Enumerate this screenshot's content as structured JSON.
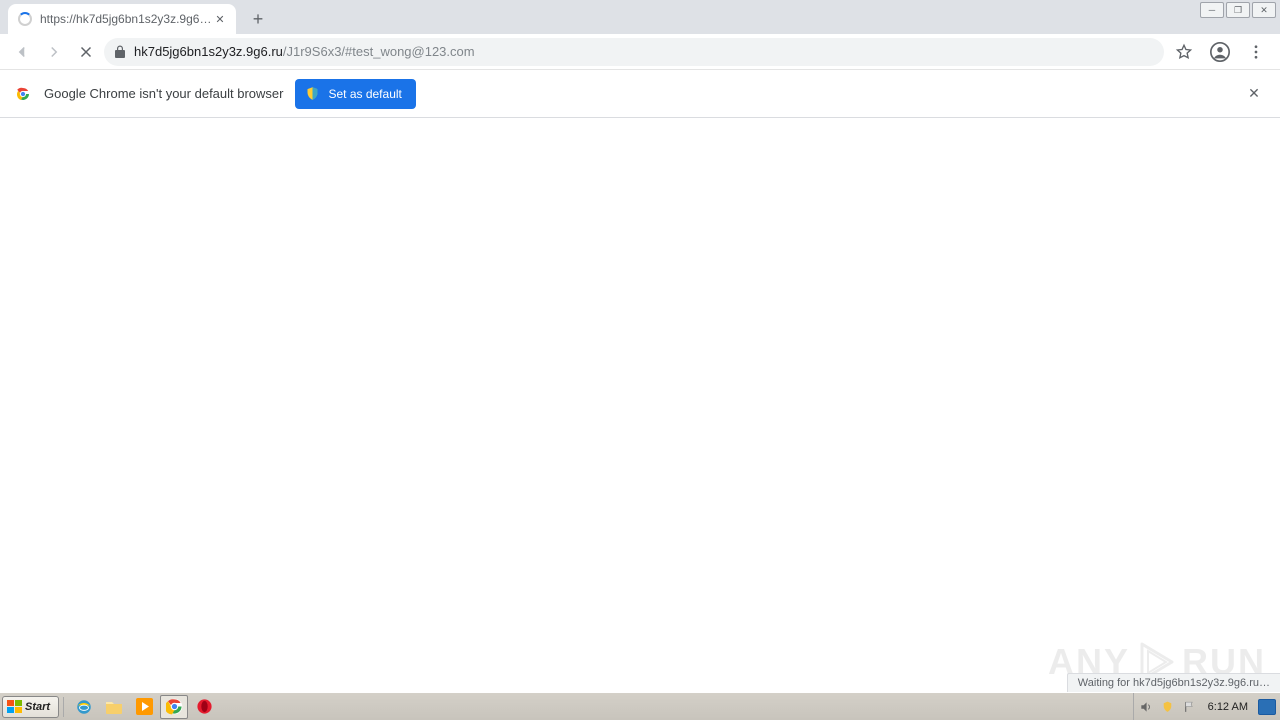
{
  "tab": {
    "title": "https://hk7d5jg6bn1s2y3z.9g6.ru/J",
    "close_glyph": "✕"
  },
  "window_controls": {
    "minimize": "─",
    "maximize": "❐",
    "close": "✕"
  },
  "nav": {
    "back_label": "Back",
    "forward_label": "Forward",
    "stop_label": "Stop loading"
  },
  "address": {
    "host": "hk7d5jg6bn1s2y3z.9g6.ru",
    "path": "/J1r9S6x3/#test_wong@123.com"
  },
  "infobar": {
    "message": "Google Chrome isn't your default browser",
    "button_label": "Set as default"
  },
  "status_text": "Waiting for hk7d5jg6bn1s2y3z.9g6.ru…",
  "watermark": {
    "left": "ANY",
    "right": "RUN"
  },
  "taskbar": {
    "start_label": "Start",
    "clock": "6:12 AM"
  }
}
